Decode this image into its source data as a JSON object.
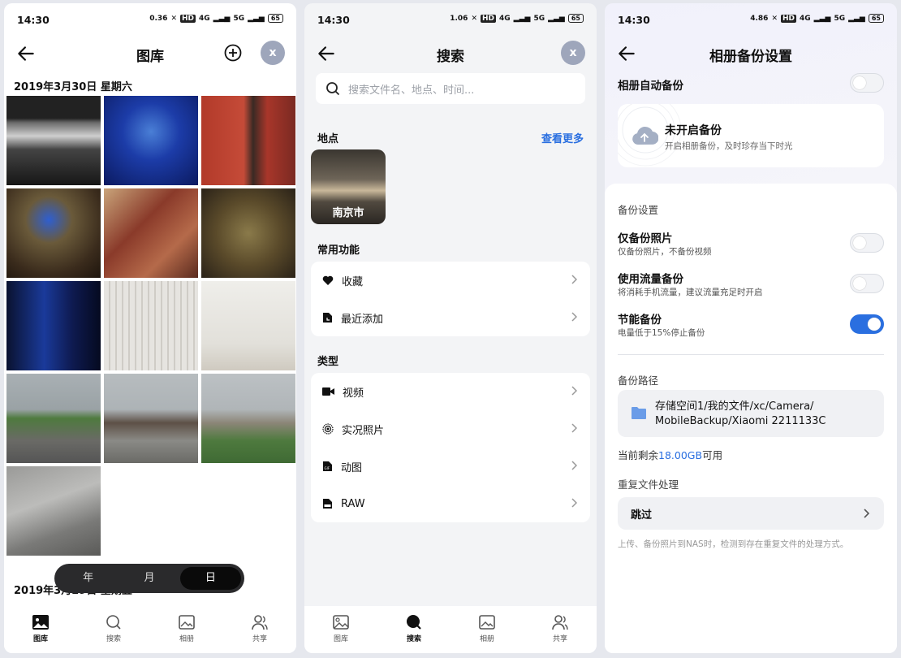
{
  "status": {
    "time": "14:30",
    "speed1": "0.36",
    "speed2": "1.06",
    "speed3": "4.86",
    "speed_unit": "KB/s",
    "hd": "HD",
    "net1": "4G",
    "net2": "5G",
    "battery": "65"
  },
  "gallery": {
    "title": "图库",
    "avatar_letter": "x",
    "date1": "2019年3月30日 星期六",
    "date2": "2019年3月29日 星期五",
    "segments": [
      "年",
      "月",
      "日"
    ],
    "active_segment": "日"
  },
  "tabs": {
    "gallery": "图库",
    "search": "搜索",
    "album": "相册",
    "share": "共享"
  },
  "search": {
    "title": "搜索",
    "placeholder": "搜索文件名、地点、时间...",
    "places_label": "地点",
    "more_label": "查看更多",
    "place_name": "南京市",
    "common_label": "常用功能",
    "favorites": "收藏",
    "recent": "最近添加",
    "types_label": "类型",
    "video": "视频",
    "live": "实况照片",
    "gif": "动图",
    "raw": "RAW"
  },
  "backup": {
    "title": "相册备份设置",
    "auto_label": "相册自动备份",
    "auto_on": false,
    "status_title": "未开启备份",
    "status_sub": "开启相册备份，及时珍存当下时光",
    "settings_label": "备份设置",
    "photos_only": "仅备份照片",
    "photos_only_sub": "仅备份照片，不备份视频",
    "photos_only_on": false,
    "mobile_data": "使用流量备份",
    "mobile_data_sub": "将消耗手机流量，建议流量充足时开启",
    "mobile_data_on": false,
    "power_save": "节能备份",
    "power_save_sub": "电量低于15%停止备份",
    "power_save_on": true,
    "path_label": "备份路径",
    "path_line1": "存储空间1/我的文件/xc/Camera/",
    "path_line2": "MobileBackup/Xiaomi 2211133C",
    "remaining_prefix": "当前剩余",
    "remaining_value": "18.00GB",
    "remaining_suffix": "可用",
    "dup_label": "重复文件处理",
    "dup_value": "跳过",
    "footer_note": "上传、备份照片到NAS时，检测到存在重复文件的处理方式。"
  },
  "colors": {
    "accent": "#2a6fe0"
  }
}
